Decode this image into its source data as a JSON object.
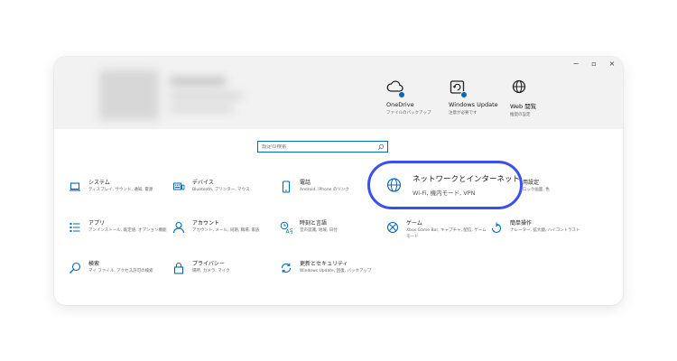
{
  "window_controls": {
    "minimize": "−",
    "maximize": "▫",
    "close": "×"
  },
  "quick_links": [
    {
      "title": "OneDrive",
      "subtitle": "ファイルのバックアップ",
      "icon": "onedrive-cloud-icon"
    },
    {
      "title": "Windows Update",
      "subtitle": "注意が必要です",
      "icon": "windows-update-icon"
    },
    {
      "title": "Web 閲覧",
      "subtitle": "推奨の設定",
      "icon": "globe-icon"
    }
  ],
  "search": {
    "placeholder": "設定の検索"
  },
  "categories": [
    {
      "title": "システム",
      "desc": "ディスプレイ, サウンド, 通知, 電源",
      "icon": "laptop-icon"
    },
    {
      "title": "デバイス",
      "desc": "Bluetooth, プリンター, マウス",
      "icon": "keyboard-icon"
    },
    {
      "title": "電話",
      "desc": "Android, iPhone のリンク",
      "icon": "phone-icon"
    },
    {
      "title": "ネットワークとインターネット",
      "desc": "Wi-Fi, 機内モード, VPN",
      "icon": "globe-icon"
    },
    {
      "title": "個人用設定",
      "desc": "背景, ロック画面, 色",
      "icon": "paintbrush-icon"
    },
    {
      "title": "アプリ",
      "desc": "アンインストール, 既定値, オプション機能",
      "icon": "apps-list-icon"
    },
    {
      "title": "アカウント",
      "desc": "アカウント, メール, 同期, 職場, 家族",
      "icon": "person-icon"
    },
    {
      "title": "時刻と言語",
      "desc": "音声認識, 地域, 日付",
      "icon": "time-language-icon"
    },
    {
      "title": "ゲーム",
      "desc": "Xbox Game Bar, キャプチャ, 配信, ゲーム モード",
      "icon": "xbox-icon"
    },
    {
      "title": "簡単操作",
      "desc": "ナレーター, 拡大鏡, ハイコントラスト",
      "icon": "ease-of-access-icon"
    },
    {
      "title": "検索",
      "desc": "マイ ファイル, アクセス許可の検索",
      "icon": "search-icon"
    },
    {
      "title": "プライバシー",
      "desc": "場所, カメラ, マイク",
      "icon": "lock-icon"
    },
    {
      "title": "更新とセキュリティ",
      "desc": "Windows Update, 回復, バックアップ",
      "icon": "sync-icon"
    }
  ],
  "colors": {
    "accent": "#0067c0",
    "highlight_border": "#3a4ff0"
  }
}
